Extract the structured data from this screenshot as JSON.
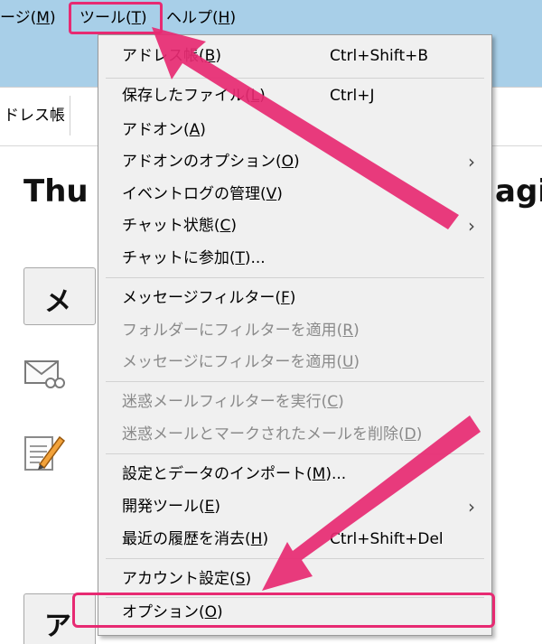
{
  "menubar": {
    "message": "ージ(M)",
    "message_text": "ージ(",
    "message_key": "M",
    "tools_text": "ツール(",
    "tools_key": "T",
    "help_text": "ヘルプ(",
    "help_key": "H",
    "close_paren": ")"
  },
  "toolbar": {
    "address_book_tab": "ドレス帳"
  },
  "page": {
    "title_left": "Thu",
    "title_right": "agi",
    "button1_fragment": "メ",
    "button2_fragment": "アカ"
  },
  "menu": {
    "items": [
      {
        "text": "アドレス帳(",
        "key": "B",
        "tail": ")",
        "shortcut": "Ctrl+Shift+B"
      },
      {
        "text": "保存したファイル(",
        "key": "L",
        "tail": ")",
        "shortcut": "Ctrl+J"
      },
      {
        "text": "アドオン(",
        "key": "A",
        "tail": ")"
      },
      {
        "text": "アドオンのオプション(",
        "key": "O",
        "tail": ")",
        "arrow": "›"
      },
      {
        "text": "イベントログの管理(",
        "key": "V",
        "tail": ")"
      },
      {
        "text": "チャット状態(",
        "key": "C",
        "tail": ")",
        "arrow": "›"
      },
      {
        "text": "チャットに参加(",
        "key": "T",
        "tail": ")..."
      },
      {
        "text": "メッセージフィルター(",
        "key": "F",
        "tail": ")"
      },
      {
        "text": "フォルダーにフィルターを適用(",
        "key": "R",
        "tail": ")"
      },
      {
        "text": "メッセージにフィルターを適用(",
        "key": "U",
        "tail": ")"
      },
      {
        "text": "迷惑メールフィルターを実行(",
        "key": "C",
        "tail": ")"
      },
      {
        "text": "迷惑メールとマークされたメールを削除(",
        "key": "D",
        "tail": ")"
      },
      {
        "text": "設定とデータのインポート(",
        "key": "M",
        "tail": ")..."
      },
      {
        "text": "開発ツール(",
        "key": "E",
        "tail": ")",
        "arrow": "›"
      },
      {
        "text": "最近の履歴を消去(",
        "key": "H",
        "tail": ")",
        "shortcut": "Ctrl+Shift+Del"
      },
      {
        "text": "アカウント設定(",
        "key": "S",
        "tail": ")"
      },
      {
        "text": "オプション(",
        "key": "O",
        "tail": ")"
      }
    ]
  },
  "colors": {
    "menubar_bg": "#a8cfe8",
    "menu_bg": "#f0f0f0",
    "highlight": "#e72a72",
    "disabled_text": "#8a8a8a"
  }
}
